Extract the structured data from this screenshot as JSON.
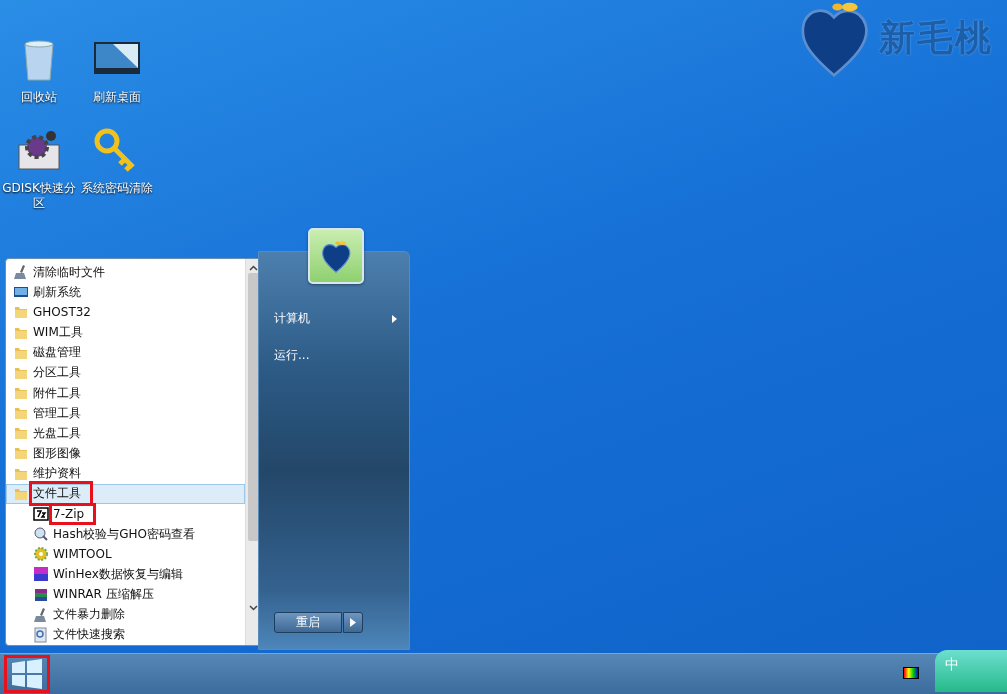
{
  "logo": {
    "text": "新毛桃"
  },
  "desktop_icons": [
    {
      "label": "回收站",
      "kind": "bin"
    },
    {
      "label": "刷新桌面",
      "kind": "monitor"
    },
    {
      "label": "GDISK快速分区",
      "kind": "gear"
    },
    {
      "label": "系统密码清除",
      "kind": "key"
    }
  ],
  "start_menu": {
    "programs": [
      {
        "label": "清除临时文件",
        "kind": "broom",
        "selected": false,
        "marked": false
      },
      {
        "label": "刷新系统",
        "kind": "monitor",
        "selected": false,
        "marked": false
      },
      {
        "label": "GHOST32",
        "kind": "folder",
        "selected": false,
        "marked": false
      },
      {
        "label": "WIM工具",
        "kind": "folder",
        "selected": false,
        "marked": false
      },
      {
        "label": "磁盘管理",
        "kind": "folder",
        "selected": false,
        "marked": false
      },
      {
        "label": "分区工具",
        "kind": "folder",
        "selected": false,
        "marked": false
      },
      {
        "label": "附件工具",
        "kind": "folder",
        "selected": false,
        "marked": false
      },
      {
        "label": "管理工具",
        "kind": "folder",
        "selected": false,
        "marked": false
      },
      {
        "label": "光盘工具",
        "kind": "folder",
        "selected": false,
        "marked": false
      },
      {
        "label": "图形图像",
        "kind": "folder",
        "selected": false,
        "marked": false
      },
      {
        "label": "维护资料",
        "kind": "folder",
        "selected": false,
        "marked": false
      },
      {
        "label": "文件工具",
        "kind": "folder",
        "selected": true,
        "marked": true,
        "children": [
          {
            "label": "7-Zip",
            "kind": "zip",
            "selected": false,
            "marked": true
          },
          {
            "label": "Hash校验与GHO密码查看",
            "kind": "hash",
            "selected": false,
            "marked": false
          },
          {
            "label": "WIMTOOL",
            "kind": "gear",
            "selected": false,
            "marked": false
          },
          {
            "label": "WinHex数据恢复与编辑",
            "kind": "hex",
            "selected": false,
            "marked": false
          },
          {
            "label": "WINRAR 压缩解压",
            "kind": "rar",
            "selected": false,
            "marked": false
          },
          {
            "label": "文件暴力删除",
            "kind": "broom",
            "selected": false,
            "marked": false
          },
          {
            "label": "文件快速搜索",
            "kind": "search",
            "selected": false,
            "marked": false
          }
        ]
      }
    ],
    "places": [
      {
        "label": "计算机",
        "submenu": true
      },
      {
        "label": "运行...",
        "submenu": false
      }
    ],
    "power_button": {
      "label": "重启"
    }
  },
  "taskbar": {
    "start_marked": true,
    "ime": {
      "label": "中"
    }
  }
}
